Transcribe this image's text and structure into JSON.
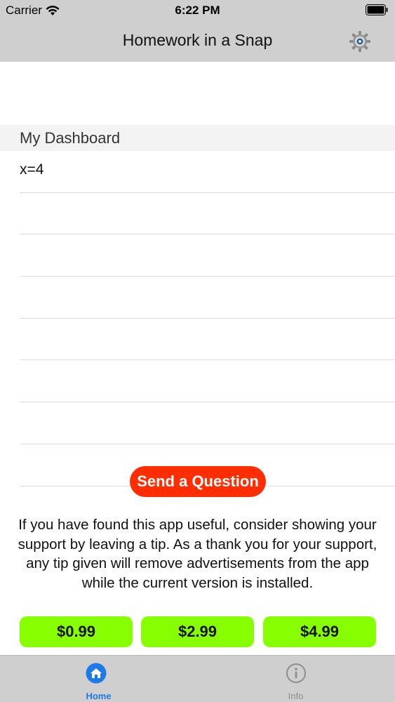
{
  "status_bar": {
    "carrier": "Carrier",
    "time": "6:22 PM",
    "icons": [
      "wifi-icon",
      "battery-icon"
    ]
  },
  "nav_bar": {
    "title": "Homework in a Snap",
    "right_icon": "gear-icon"
  },
  "dashboard": {
    "section_title": "My Dashboard",
    "rows": [
      "x=4",
      "",
      "",
      "",
      "",
      "",
      "",
      ""
    ]
  },
  "actions": {
    "send_question_label": "Send a Question"
  },
  "tips": {
    "message": "If you have found this app useful, consider showing your support by leaving a tip. As a thank you for your support, any tip given will remove advertisements from the app while the current version is installed.",
    "options": [
      "$0.99",
      "$2.99",
      "$4.99"
    ]
  },
  "tab_bar": {
    "tabs": [
      {
        "label": "Home",
        "icon": "home-icon",
        "selected": true
      },
      {
        "label": "Info",
        "icon": "info-icon",
        "selected": false
      }
    ]
  },
  "colors": {
    "accent": "#1e7ae8",
    "send_button": "#ff2d00",
    "tip_button": "#88ff00",
    "bar_background": "#cfcfcf"
  }
}
